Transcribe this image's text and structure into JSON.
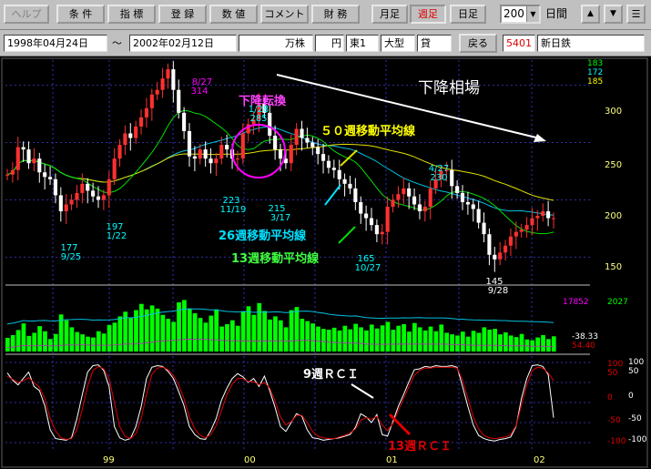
{
  "toolbar": {
    "buttons": [
      "ヘルプ",
      "条 件",
      "指 標",
      "登 録",
      "数 値",
      "コメント",
      "財 務",
      "月足",
      "週足",
      "日足"
    ],
    "period_value": "200",
    "period_unit": "日間"
  },
  "info": {
    "start_date": "1998年04月24日",
    "separator": "～",
    "end_date": "2002年02月12日",
    "unit": "万株",
    "currency": "円",
    "market": "東1",
    "size": "大型",
    "credit": "貸",
    "back_label": "戻る",
    "code": "5401",
    "name": "新日鉄"
  },
  "colors": {
    "price_axis": "#ffff80",
    "volume": "#00ff00",
    "rci9": "#ffffff",
    "rci13": "#e00000",
    "ma13": "#00e000",
    "ma26": "#00c0e0",
    "ma50": "#e0e000",
    "accent_magenta": "#ff00ff"
  },
  "chart_data": [
    {
      "type": "candlestick",
      "title": "下降相場",
      "x_tick_labels": [
        "99",
        "00",
        "01",
        "02"
      ],
      "y_ticks": [
        300,
        250,
        200,
        150
      ],
      "ylim": [
        128,
        322
      ],
      "right_values": {
        "col1": [
          "183",
          "172"
        ],
        "col2": "185"
      },
      "series_labels": {
        "ma50": "５０週移動平均線",
        "ma26": "26週移動平均線",
        "ma13": "13週移動平均線"
      },
      "annotations": [
        {
          "label_top": "8/27",
          "label_bottom": "314",
          "value": 314
        },
        {
          "label_top": "1/28",
          "label_bottom": "285",
          "value": 285
        },
        {
          "label_top": "4/27",
          "label_bottom": "230",
          "value": 230
        },
        {
          "label_top": "177",
          "label_bottom": "9/25",
          "value": 177
        },
        {
          "label_top": "197",
          "label_bottom": "1/22",
          "value": 197
        },
        {
          "label_top": "223",
          "label_bottom": "11/19",
          "value": 223
        },
        {
          "label_top": "215",
          "label_bottom": "3/17",
          "value": 215
        },
        {
          "label_top": "165",
          "label_bottom": "10/27",
          "value": 165
        },
        {
          "label_top": "145",
          "label_bottom": "9/28",
          "value": 145
        }
      ],
      "highlight_label": "下降転換",
      "closes": [
        222,
        226,
        246,
        244,
        232,
        236,
        224,
        220,
        218,
        204,
        190,
        196,
        200,
        206,
        214,
        208,
        203,
        200,
        204,
        218,
        236,
        248,
        258,
        254,
        264,
        272,
        280,
        292,
        296,
        306,
        314,
        296,
        276,
        260,
        238,
        236,
        244,
        236,
        232,
        236,
        248,
        244,
        236,
        236,
        258,
        266,
        270,
        284,
        276,
        256,
        244,
        236,
        232,
        248,
        262,
        254,
        250,
        246,
        240,
        234,
        228,
        226,
        218,
        214,
        210,
        198,
        188,
        184,
        178,
        170,
        172,
        194,
        200,
        205,
        210,
        203,
        196,
        190,
        194,
        210,
        218,
        225,
        226,
        212,
        206,
        198,
        196,
        192,
        180,
        170,
        152,
        148,
        154,
        160,
        168,
        172,
        174,
        178,
        184,
        186,
        190,
        184,
        184
      ]
    },
    {
      "type": "bar",
      "title": "volume",
      "right_values": {
        "line_value": "17852",
        "series_value": "2027"
      },
      "values": [
        3500,
        4200,
        5500,
        7200,
        4000,
        4800,
        6500,
        5200,
        3200,
        4500,
        9500,
        8000,
        6200,
        5000,
        4400,
        3800,
        3600,
        5200,
        4600,
        6800,
        7400,
        9000,
        10200,
        8600,
        10600,
        12200,
        10800,
        11800,
        11000,
        9400,
        8400,
        7600,
        12600,
        13200,
        11000,
        9800,
        8600,
        7400,
        9200,
        10800,
        6400,
        7000,
        8000,
        6600,
        10200,
        11600,
        9400,
        12400,
        10400,
        8200,
        9000,
        8000,
        6200,
        10600,
        11400,
        8400,
        7800,
        7200,
        6400,
        5800,
        5600,
        6100,
        5400,
        6600,
        5700,
        7100,
        6200,
        5400,
        6900,
        5900,
        6700,
        7600,
        5600,
        6600,
        7000,
        5100,
        7300,
        6200,
        5400,
        6400,
        5200,
        6900,
        4800,
        4400,
        4100,
        5100,
        3800,
        5300,
        4800,
        6200,
        5600,
        5800,
        4400,
        4900,
        4100,
        3700,
        4500,
        3100,
        2900,
        3600,
        4200,
        3200,
        3900
      ]
    },
    {
      "type": "line",
      "title": "RCI",
      "ylim": [
        -100,
        100
      ],
      "y_ticks_red": [
        "100",
        "50",
        "0",
        "-50",
        "-100"
      ],
      "y_ticks_white": [
        "100",
        "50",
        "0",
        "-50",
        "-100"
      ],
      "right_values": {
        "rci9": "-38.33",
        "rci13": "54.40"
      },
      "series_labels": {
        "rci9": "9週ＲＣＩ",
        "rci13": "13週ＲＣＩ"
      },
      "series": [
        {
          "name": "9週ＲＣＩ",
          "values": [
            74,
            56,
            44,
            60,
            76,
            40,
            30,
            -8,
            -68,
            -90,
            -92,
            -94,
            -88,
            -40,
            20,
            76,
            92,
            94,
            80,
            40,
            -60,
            -88,
            -94,
            -90,
            -60,
            -10,
            60,
            88,
            92,
            90,
            78,
            60,
            28,
            -8,
            -60,
            -80,
            -90,
            -92,
            -70,
            -40,
            6,
            36,
            60,
            72,
            64,
            50,
            60,
            40,
            66,
            30,
            -12,
            -60,
            -72,
            -50,
            -28,
            -34,
            -68,
            -88,
            -90,
            -94,
            -92,
            -90,
            -88,
            -84,
            -80,
            -62,
            -28,
            -36,
            -50,
            -30,
            -80,
            -84,
            -48,
            -10,
            20,
            52,
            82,
            84,
            90,
            88,
            92,
            90,
            90,
            92,
            88,
            40,
            -10,
            -56,
            -82,
            -90,
            -94,
            -96,
            -92,
            -90,
            -86,
            -60,
            10,
            60,
            92,
            94,
            90,
            70,
            -38
          ]
        },
        {
          "name": "13週ＲＣＩ",
          "values": [
            66,
            58,
            50,
            54,
            62,
            50,
            38,
            10,
            -40,
            -70,
            -88,
            -92,
            -90,
            -68,
            -16,
            40,
            80,
            90,
            84,
            60,
            0,
            -60,
            -84,
            -90,
            -78,
            -40,
            20,
            70,
            86,
            88,
            82,
            68,
            44,
            10,
            -36,
            -66,
            -82,
            -88,
            -80,
            -58,
            -20,
            20,
            46,
            60,
            60,
            52,
            52,
            44,
            50,
            36,
            4,
            -36,
            -56,
            -48,
            -32,
            -32,
            -50,
            -72,
            -84,
            -88,
            -90,
            -90,
            -86,
            -82,
            -76,
            -66,
            -44,
            -38,
            -42,
            -34,
            -56,
            -70,
            -52,
            -20,
            10,
            40,
            68,
            80,
            86,
            86,
            88,
            88,
            88,
            88,
            86,
            56,
            10,
            -36,
            -66,
            -82,
            -88,
            -90,
            -88,
            -86,
            -80,
            -58,
            -6,
            44,
            80,
            88,
            86,
            74,
            54
          ]
        }
      ]
    }
  ]
}
